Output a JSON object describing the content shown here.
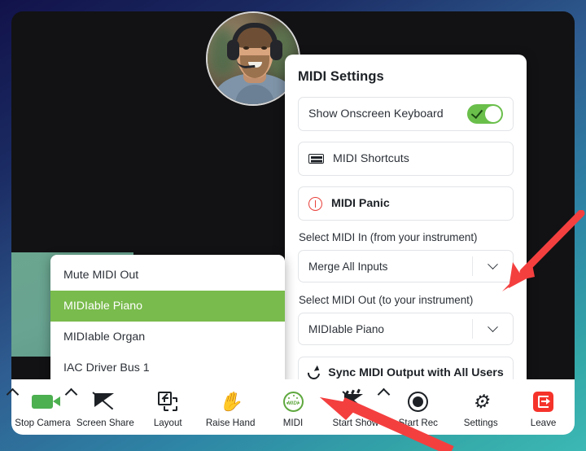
{
  "meeting": {
    "avatar_alt": "participant-video-avatar",
    "participant_tile_alt": "participant-video-tile"
  },
  "midi_panel": {
    "title": "MIDI Settings",
    "onscreen_keyboard": {
      "label": "Show Onscreen Keyboard",
      "toggle_state": "on",
      "toggle_color": "#6abf4b"
    },
    "shortcuts": {
      "label": "MIDI Shortcuts",
      "icon": "keyboard-icon"
    },
    "panic": {
      "label": "MIDI Panic",
      "icon": "alert-circle-icon",
      "accent_color": "#e8403a"
    },
    "midi_in": {
      "label": "Select MIDI In (from your instrument)",
      "value": "Merge All Inputs",
      "chevron": "chevron-down-icon"
    },
    "midi_out": {
      "label": "Select MIDI Out (to your instrument)",
      "value": "MIDIable Piano",
      "chevron": "chevron-down-icon"
    },
    "sync": {
      "label": "Sync MIDI Output with All Users",
      "icon": "refresh-icon"
    }
  },
  "midi_out_menu": {
    "items": [
      {
        "label": "Mute MIDI Out",
        "selected": false
      },
      {
        "label": "MIDIable Piano",
        "selected": true
      },
      {
        "label": "MIDIable Organ",
        "selected": false
      },
      {
        "label": "IAC Driver Bus 1",
        "selected": false
      }
    ],
    "selected_color": "#79bb4c"
  },
  "toolbar": {
    "items": [
      {
        "label": "Stop Camera",
        "icon": "video-camera-icon",
        "caret_left": true,
        "caret_right": true
      },
      {
        "label": "Screen Share",
        "icon": "screen-share-off-icon",
        "caret_left": false,
        "caret_right": false
      },
      {
        "label": "Layout",
        "icon": "layout-icon",
        "caret_left": false,
        "caret_right": false
      },
      {
        "label": "Raise Hand",
        "icon": "raise-hand-icon",
        "caret_left": false,
        "caret_right": false
      },
      {
        "label": "MIDI",
        "icon": "midi-din-icon",
        "caret_left": false,
        "caret_right": false
      },
      {
        "label": "Start Show",
        "icon": "start-show-icon",
        "caret_left": false,
        "caret_right": true
      },
      {
        "label": "Start Rec",
        "icon": "record-icon",
        "caret_left": false,
        "caret_right": false
      },
      {
        "label": "Settings",
        "icon": "gear-icon",
        "caret_left": false,
        "caret_right": false
      },
      {
        "label": "Leave",
        "icon": "leave-icon",
        "caret_left": false,
        "caret_right": false
      }
    ],
    "midi_icon_color": "#5fa83f",
    "camera_icon_color": "#4caf50",
    "leave_icon_color": "#f5332b"
  },
  "annotations": {
    "arrow_color": "#f43f3f",
    "arrows": [
      {
        "name": "arrow-to-midi-out-select",
        "points_to": "midi_out select"
      },
      {
        "name": "arrow-to-midi-toolbar-button",
        "points_to": "MIDI toolbar button"
      }
    ]
  }
}
